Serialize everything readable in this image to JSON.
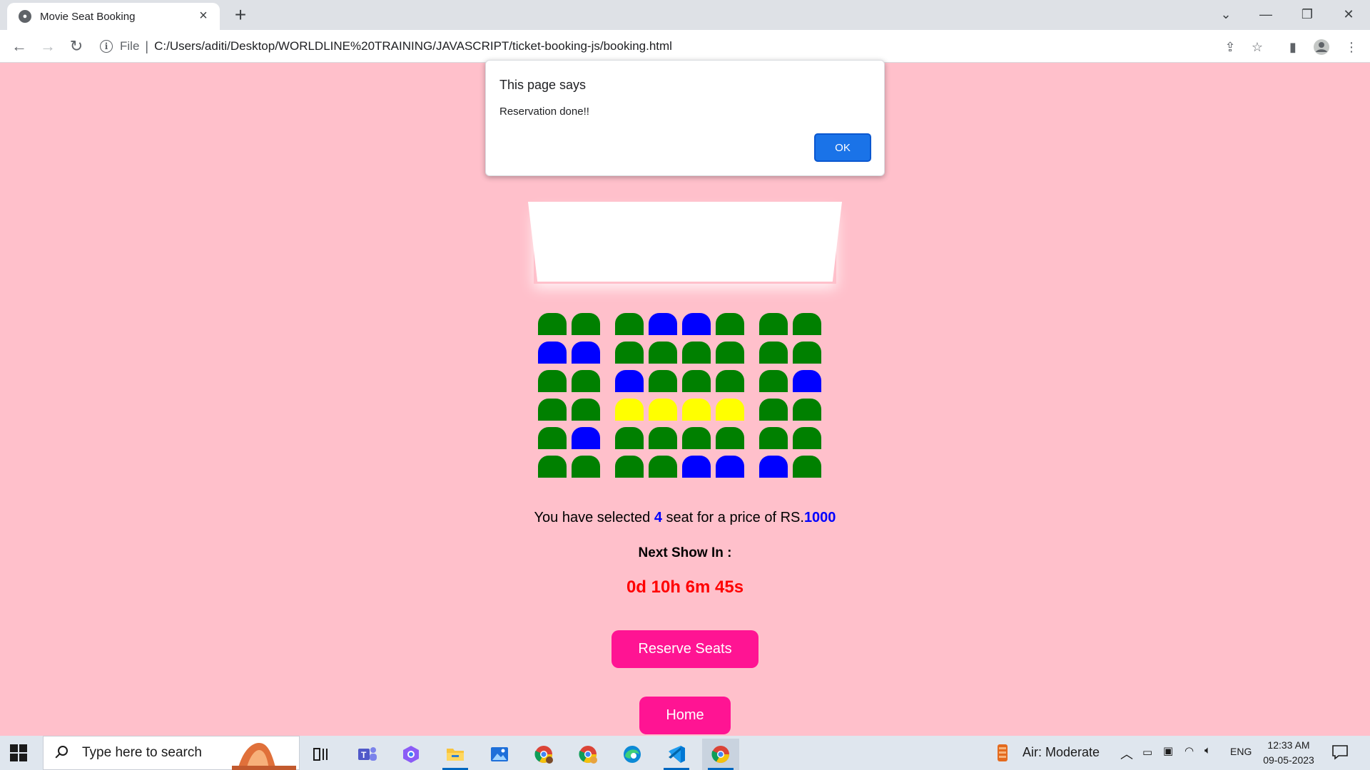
{
  "browser": {
    "tab_title": "Movie Seat Booking",
    "file_label": "File",
    "url": "C:/Users/aditi/Desktop/WORLDLINE%20TRAINING/JAVASCRIPT/ticket-booking-js/booking.html"
  },
  "dialog": {
    "title": "This page says",
    "message": "Reservation done!!",
    "ok_label": "OK"
  },
  "seat_legend": {
    "available": "#008000",
    "occupied": "#0000ff",
    "selected": "#ffff00"
  },
  "seat_rows": [
    [
      "available",
      "available",
      "available",
      "occupied",
      "occupied",
      "available",
      "available",
      "available"
    ],
    [
      "occupied",
      "occupied",
      "available",
      "available",
      "available",
      "available",
      "available",
      "available"
    ],
    [
      "available",
      "available",
      "occupied",
      "available",
      "available",
      "available",
      "available",
      "occupied"
    ],
    [
      "available",
      "available",
      "selected",
      "selected",
      "selected",
      "selected",
      "available",
      "available"
    ],
    [
      "available",
      "occupied",
      "available",
      "available",
      "available",
      "available",
      "available",
      "available"
    ],
    [
      "available",
      "available",
      "available",
      "available",
      "occupied",
      "occupied",
      "occupied",
      "available"
    ]
  ],
  "summary": {
    "prefix": "You have selected ",
    "count": "4",
    "middle": " seat for a price of RS.",
    "price": "1000"
  },
  "next_show": {
    "label": "Next Show In :",
    "countdown": "0d 10h 6m 45s"
  },
  "buttons": {
    "reserve": "Reserve Seats",
    "home": "Home"
  },
  "taskbar": {
    "search_placeholder": "Type here to search",
    "air_quality": "Air: Moderate",
    "language": "ENG",
    "time": "12:33 AM",
    "date": "09-05-2023"
  }
}
